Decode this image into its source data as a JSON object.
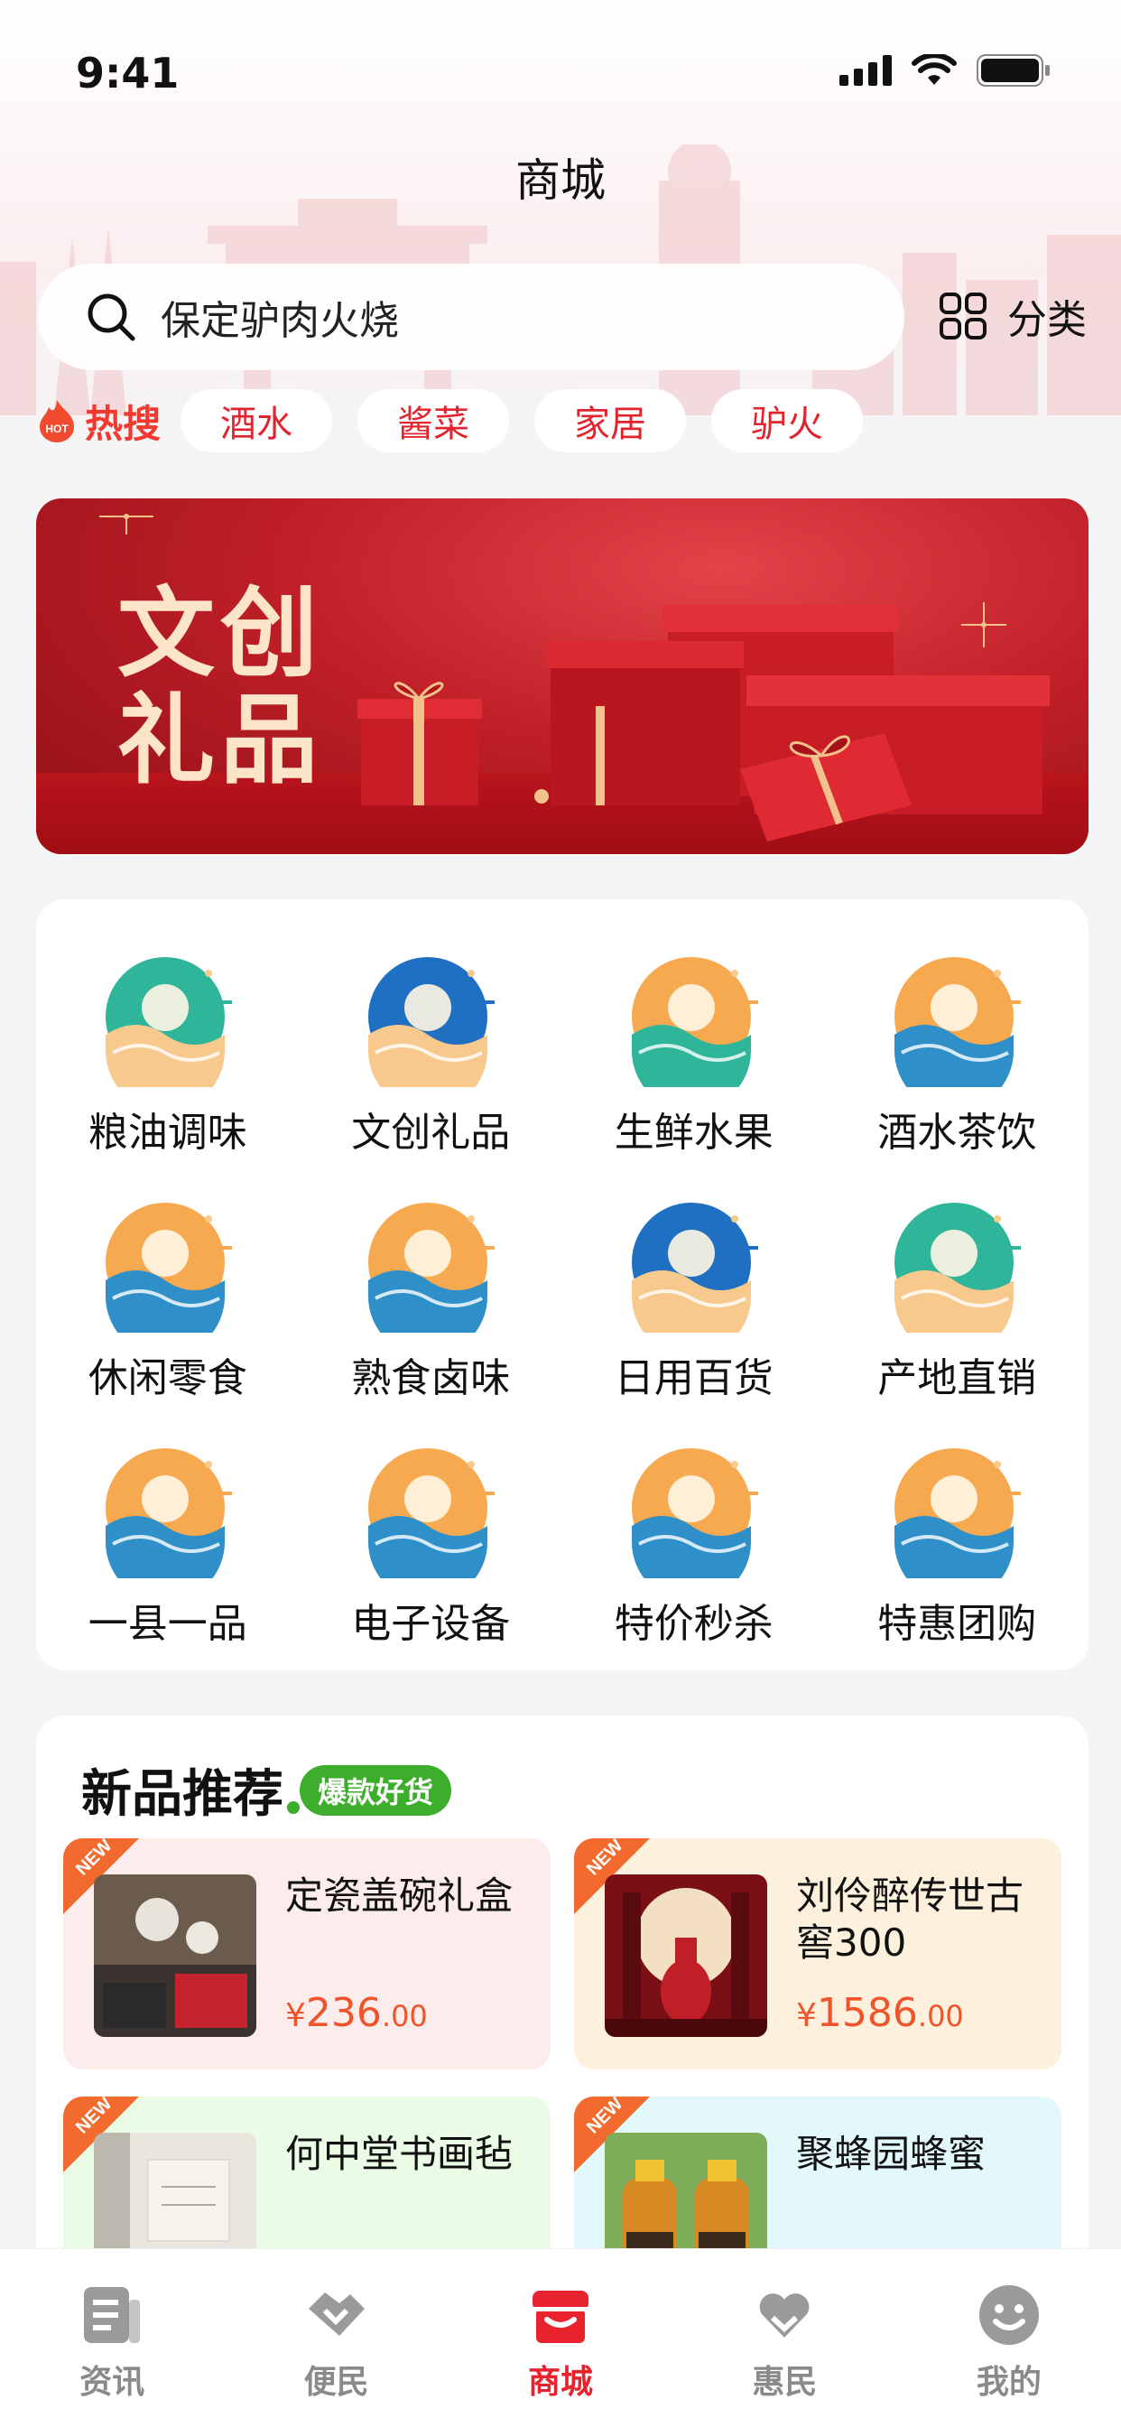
{
  "status_bar": {
    "time": "9:41"
  },
  "header": {
    "title": "商城"
  },
  "search": {
    "value": "保定驴肉火烧",
    "category_label": "分类"
  },
  "hot_search": {
    "badge_text": "HOT",
    "label": "热搜",
    "chips": [
      "酒水",
      "酱菜",
      "家居",
      "驴火"
    ]
  },
  "banner": {
    "title_line1": "文创",
    "title_line2": "礼品"
  },
  "categories": [
    {
      "label": "粮油调味",
      "icon": "grain-oil-icon"
    },
    {
      "label": "文创礼品",
      "icon": "lion-dance-icon"
    },
    {
      "label": "生鲜水果",
      "icon": "fish-icon"
    },
    {
      "label": "酒水茶饮",
      "icon": "wine-jar-icon"
    },
    {
      "label": "休闲零食",
      "icon": "snack-icon"
    },
    {
      "label": "熟食卤味",
      "icon": "fan-icon"
    },
    {
      "label": "日用百货",
      "icon": "gift-box-icon"
    },
    {
      "label": "产地直销",
      "icon": "lotus-icon"
    },
    {
      "label": "一县一品",
      "icon": "county-skyline-icon"
    },
    {
      "label": "电子设备",
      "icon": "phone-icon"
    },
    {
      "label": "特价秒杀",
      "icon": "lightning-icon"
    },
    {
      "label": "特惠团购",
      "icon": "shopping-bag-icon"
    }
  ],
  "new_products": {
    "title": "新品推荐",
    "tag": "爆款好货",
    "corner_label": "NEW",
    "items": [
      {
        "name": "定瓷盖碗礼盒",
        "currency": "¥",
        "price_int": "236",
        "price_dec": ".00",
        "bg": "#fdecec"
      },
      {
        "name": "刘伶醉传世古窖300",
        "currency": "¥",
        "price_int": "1586",
        "price_dec": ".00",
        "bg": "#fdf1de"
      },
      {
        "name": "何中堂书画毡",
        "currency": "",
        "price_int": "",
        "price_dec": "",
        "bg": "#eafbe6"
      },
      {
        "name": "聚蜂园蜂蜜",
        "currency": "",
        "price_int": "",
        "price_dec": "",
        "bg": "#e3f8fb"
      }
    ]
  },
  "tab_bar": {
    "tabs": [
      {
        "label": "资讯",
        "icon": "news-icon",
        "active": false
      },
      {
        "label": "便民",
        "icon": "handshake-icon",
        "active": false
      },
      {
        "label": "商城",
        "icon": "store-icon",
        "active": true
      },
      {
        "label": "惠民",
        "icon": "heart-hands-icon",
        "active": false
      },
      {
        "label": "我的",
        "icon": "profile-face-icon",
        "active": false
      }
    ]
  },
  "colors": {
    "accent": "#e8232e",
    "price": "#f0542b",
    "hot": "#f0392f",
    "tag_green": "#3dae2b",
    "banner_red": "#c01f27"
  }
}
